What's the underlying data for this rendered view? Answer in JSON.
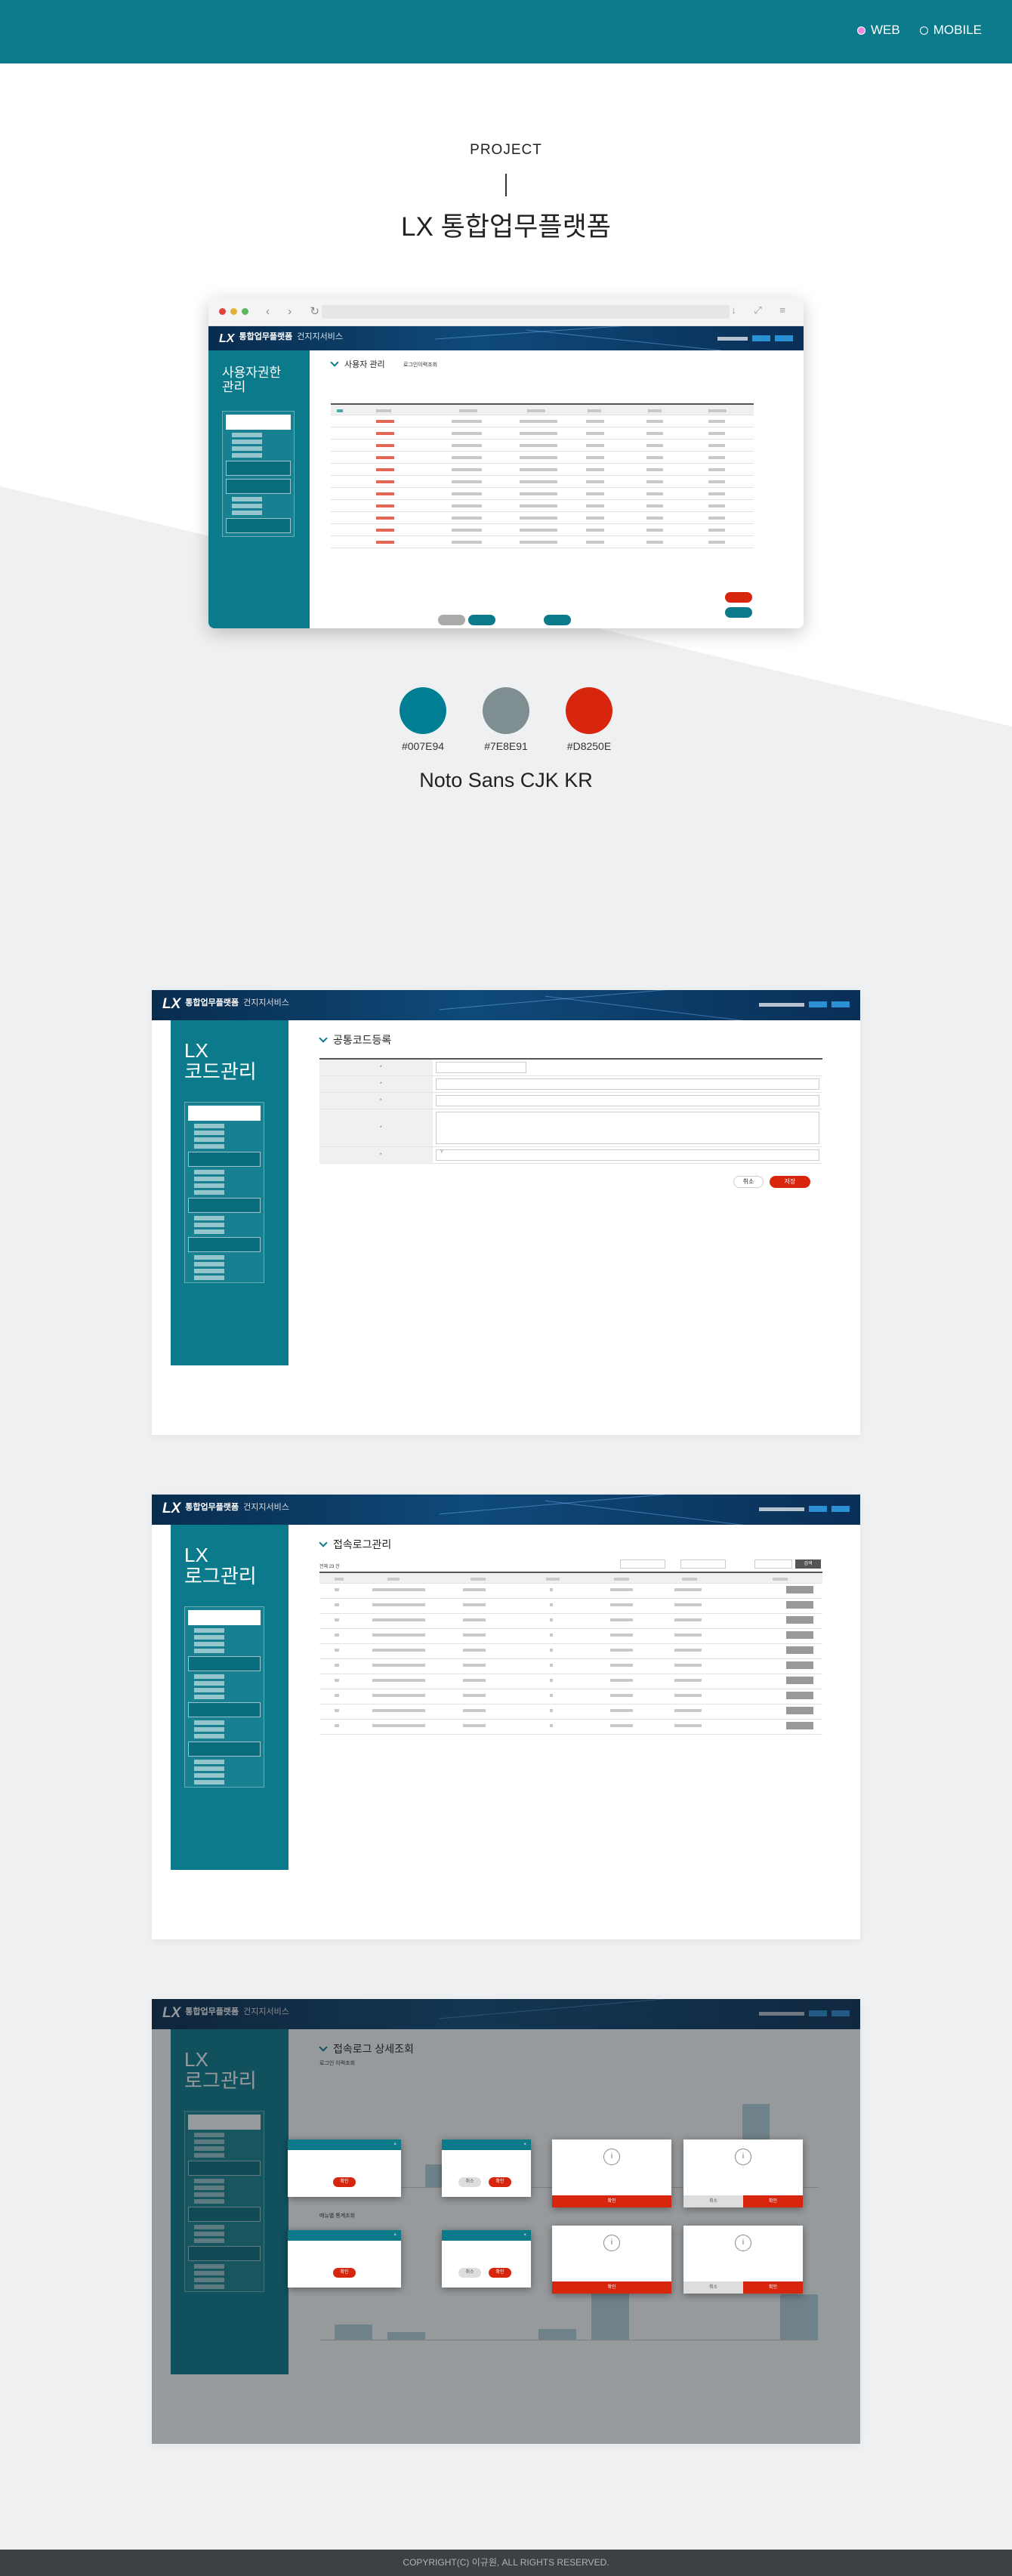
{
  "nav": {
    "web": "WEB",
    "mobile": "MOBILE"
  },
  "hero": {
    "label": "PROJECT",
    "title": "LX 통합업무플랫폼",
    "font": "Noto Sans CJK KR"
  },
  "colors": [
    {
      "hex": "#007E94",
      "label": "#007E94"
    },
    {
      "hex": "#7E8E91",
      "label": "#7E8E91"
    },
    {
      "hex": "#D8250E",
      "label": "#D8250E"
    }
  ],
  "app": {
    "logo": "LX",
    "system": "통합업무플랫폼",
    "service": "건지지서비스"
  },
  "screens": {
    "users": {
      "sidebar_title": "사용자권한\n관리",
      "page_title": "사용자 관리",
      "tab": "로그인이력조회"
    },
    "code": {
      "sidebar_title": "LX\n코드관리",
      "page_title": "공통코드등록",
      "save": "저장",
      "cancel": "취소",
      "use_value": "Y"
    },
    "log": {
      "sidebar_title": "LX\n로그관리",
      "page_title": "접속로그관리",
      "total": "전체 23 건",
      "search": "검색"
    },
    "detail": {
      "sidebar_title": "LX\n로그관리",
      "page_title": "접속로그 상세조회",
      "section1": "로그인 이력조회",
      "section2": "메뉴별 통계조회",
      "ok": "확인",
      "cancel": "취소"
    }
  },
  "footer": "COPYRIGHT(C) 이규원, ALL RIGHTS RESERVED."
}
